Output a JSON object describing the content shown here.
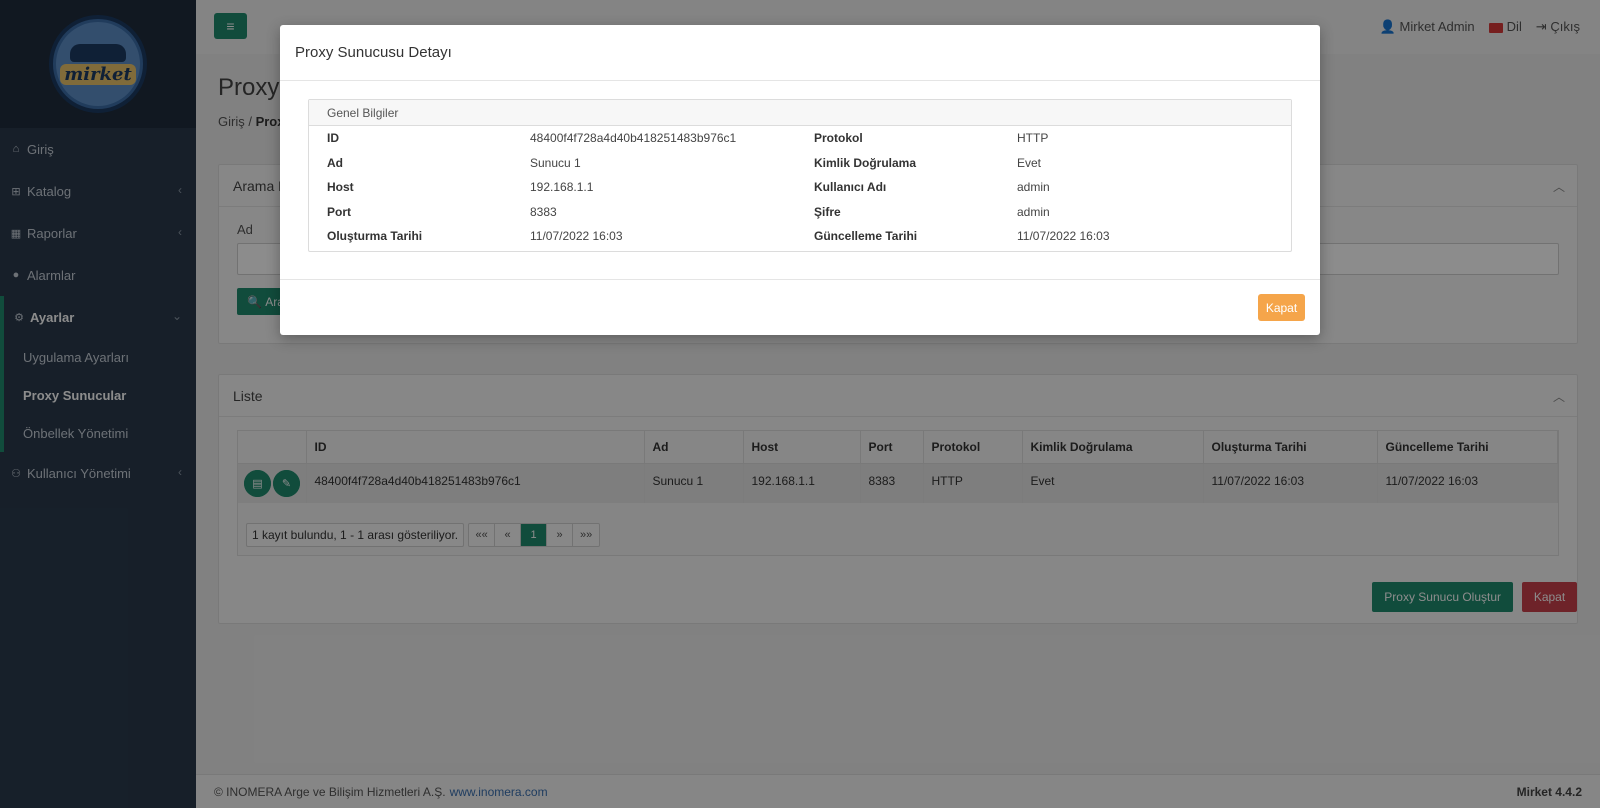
{
  "sidebar": {
    "logo_text": "mirket",
    "items": [
      {
        "label": "Giriş",
        "icon": "home-icon"
      },
      {
        "label": "Katalog",
        "icon": "sitemap-icon"
      },
      {
        "label": "Raporlar",
        "icon": "chart-icon"
      },
      {
        "label": "Alarmlar",
        "icon": "bell-icon"
      },
      {
        "label": "Ayarlar",
        "icon": "cogs-icon"
      },
      {
        "label": "Kullanıcı Yönetimi",
        "icon": "users-icon"
      }
    ],
    "submenu": [
      {
        "label": "Uygulama Ayarları"
      },
      {
        "label": "Proxy Sunucular"
      },
      {
        "label": "Önbellek Yönetimi"
      }
    ]
  },
  "topbar": {
    "user": "Mirket Admin",
    "lang": "Dil",
    "logout": "Çıkış"
  },
  "page": {
    "title": "Proxy Sunucular",
    "breadcrumb_home": "Giriş",
    "breadcrumb_current": "Proxy Sunucular"
  },
  "search": {
    "title": "Arama Kriterleri",
    "name_label": "Ad",
    "search_button": "Ara"
  },
  "list": {
    "title": "Liste",
    "columns": [
      "ID",
      "Ad",
      "Host",
      "Port",
      "Protokol",
      "Kimlik Doğrulama",
      "Oluşturma Tarihi",
      "Güncelleme Tarihi"
    ],
    "rows": [
      [
        "48400f4f728a4d40b418251483b976c1",
        "Sunucu 1",
        "192.168.1.1",
        "8383",
        "HTTP",
        "Evet",
        "11/07/2022 16:03",
        "11/07/2022 16:03"
      ]
    ],
    "pager_info": "1 kayıt bulundu, 1 - 1 arası gösteriliyor.",
    "pager": [
      "««",
      "«",
      "1",
      "»",
      "»»"
    ],
    "create_button": "Proxy Sunucu Oluştur",
    "close_button": "Kapat"
  },
  "modal": {
    "title": "Proxy Sunucusu Detayı",
    "card_title": "Genel Bilgiler",
    "fields": [
      {
        "k1": "ID",
        "v1": "48400f4f728a4d40b418251483b976c1",
        "k2": "Protokol",
        "v2": "HTTP"
      },
      {
        "k1": "Ad",
        "v1": "Sunucu 1",
        "k2": "Kimlik Doğrulama",
        "v2": "Evet"
      },
      {
        "k1": "Host",
        "v1": "192.168.1.1",
        "k2": "Kullanıcı Adı",
        "v2": "admin"
      },
      {
        "k1": "Port",
        "v1": "8383",
        "k2": "Şifre",
        "v2": "admin"
      },
      {
        "k1": "Oluşturma Tarihi",
        "v1": "11/07/2022 16:03",
        "k2": "Güncelleme Tarihi",
        "v2": "11/07/2022 16:03"
      }
    ],
    "close_button": "Kapat"
  },
  "footer": {
    "copyright": "© INOMERA Arge ve Bilişim Hizmetleri A.Ş.",
    "link": "www.inomera.com",
    "version": "Mirket 4.4.2"
  },
  "colors": {
    "primary": "#1f8a6e",
    "danger": "#c9404c",
    "warning": "#f5a54a",
    "sidebar": "#2a3a4c"
  }
}
